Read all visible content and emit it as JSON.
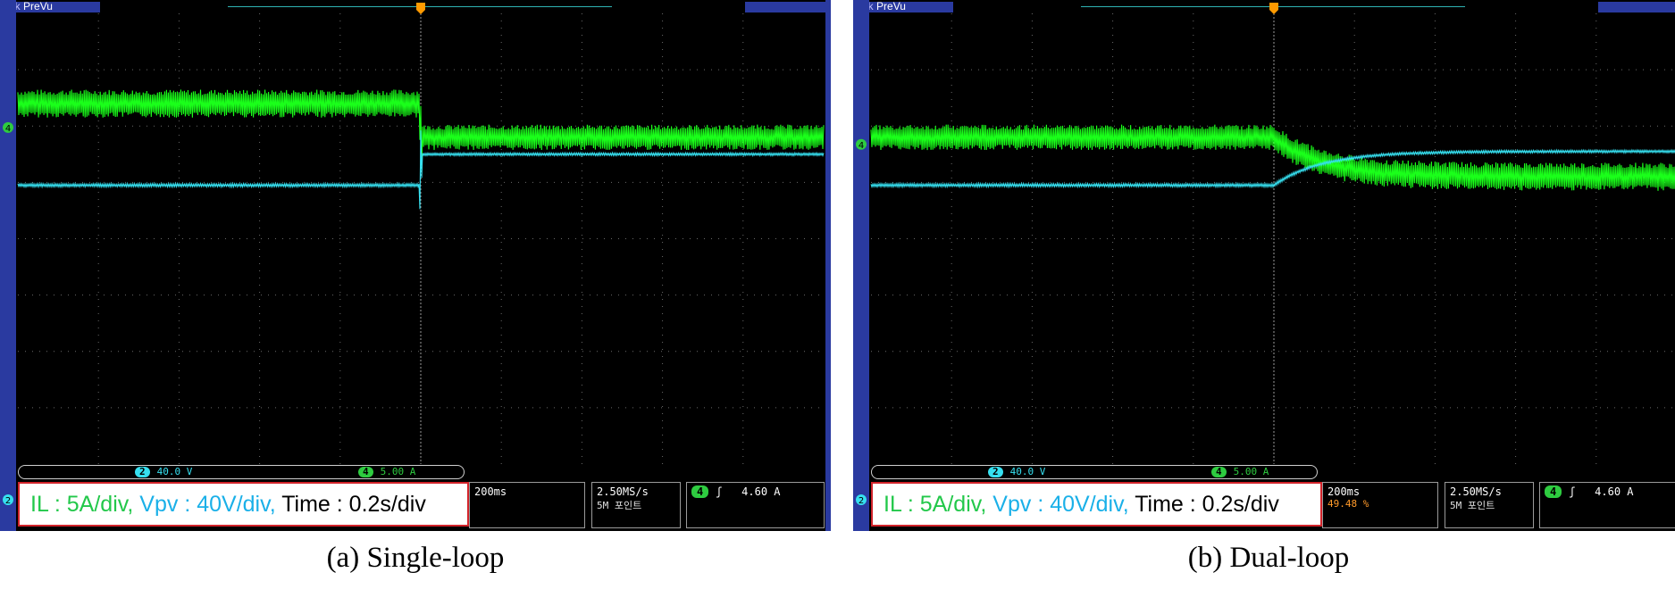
{
  "panels": [
    {
      "id": "a",
      "brand": "Tek",
      "brand_mode": "PreVu",
      "caption": "(a) Single-loop",
      "channel_bar": {
        "ch2_badge": "2",
        "ch2_scale": "40.0 V",
        "ch4_badge": "4",
        "ch4_scale": "5.00 A"
      },
      "label": {
        "il": "IL : 5A/div,",
        "vpv": "Vpv : 40V/div,",
        "time": "Time : 0.2s/div"
      },
      "timebase": "200ms",
      "sample_rate": "2.50MS/s",
      "record": "5M 포인트",
      "trigger": {
        "badge": "4",
        "symbol": "ʃ",
        "level": "4.60 A"
      },
      "ch4_marker": "4",
      "ch2_marker": "2"
    },
    {
      "id": "b",
      "brand": "Tek",
      "brand_mode": "PreVu",
      "caption": "(b) Dual-loop",
      "channel_bar": {
        "ch2_badge": "2",
        "ch2_scale": "40.0 V",
        "ch4_badge": "4",
        "ch4_scale": "5.00 A"
      },
      "label": {
        "il": "IL : 5A/div,",
        "vpv": "Vpv : 40V/div,",
        "time": "Time : 0.2s/div"
      },
      "timebase": "200ms",
      "trigger_pos": "49.48 %",
      "sample_rate": "2.50MS/s",
      "record": "5M 포인트",
      "trigger": {
        "badge": "4",
        "symbol": "ʃ",
        "level": "4.60 A"
      },
      "ch4_marker": "4",
      "ch2_marker": "2"
    }
  ],
  "colors": {
    "il_trace": "#1aff1a",
    "vpv_trace": "#36e0f0",
    "grid": "#6a6a6a",
    "trigger": "#ff9a00",
    "frame": "#2a3aa0"
  },
  "chart_data": [
    {
      "type": "line",
      "title": "(a) Single-loop",
      "x_divisions": 10,
      "y_divisions": 8,
      "xlim": [
        0,
        2.0
      ],
      "x_unit": "s",
      "trigger_time": 1.0,
      "series": [
        {
          "name": "IL : 5A/div",
          "scale_per_div": 5,
          "unit": "A",
          "color": "#1aff1a",
          "before": {
            "center_div": 6.4,
            "ripple_div": 0.5
          },
          "after": {
            "center_div": 5.8,
            "ripple_div": 0.45
          },
          "transition": "step"
        },
        {
          "name": "Vpv : 40V/div",
          "scale_per_div": 40,
          "unit": "V",
          "color": "#36e0f0",
          "before": {
            "center_div": 4.95,
            "ripple_div": 0.06
          },
          "after": {
            "center_div": 5.5,
            "ripple_div": 0.05
          },
          "transition": "step"
        }
      ]
    },
    {
      "type": "line",
      "title": "(b) Dual-loop",
      "x_divisions": 10,
      "y_divisions": 8,
      "xlim": [
        0,
        2.0
      ],
      "x_unit": "s",
      "trigger_time": 1.0,
      "series": [
        {
          "name": "IL : 5A/div",
          "scale_per_div": 5,
          "unit": "A",
          "color": "#1aff1a",
          "before": {
            "center_div": 5.8,
            "ripple_div": 0.45
          },
          "after": {
            "center_div": 5.1,
            "ripple_div": 0.5
          },
          "transition": "smooth"
        },
        {
          "name": "Vpv : 40V/div",
          "scale_per_div": 40,
          "unit": "V",
          "color": "#36e0f0",
          "before": {
            "center_div": 4.95,
            "ripple_div": 0.06
          },
          "after": {
            "center_div": 5.55,
            "ripple_div": 0.05
          },
          "transition": "smooth"
        }
      ]
    }
  ]
}
